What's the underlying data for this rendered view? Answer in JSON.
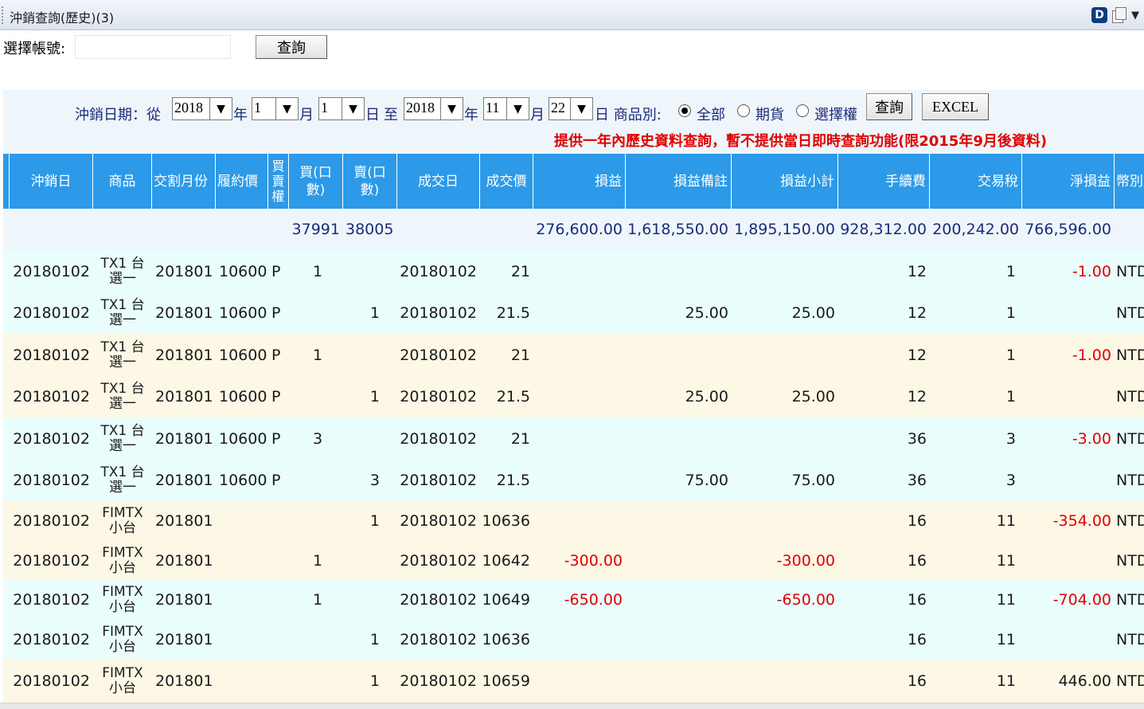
{
  "window": {
    "title": "沖銷查詢(歷史)(3)"
  },
  "account": {
    "label": "選擇帳號:",
    "value": "",
    "query_button": "查詢"
  },
  "filter": {
    "date_label": "沖銷日期：從",
    "from_year": "2018",
    "from_month": "1",
    "from_day": "1",
    "to_year": "2018",
    "to_month": "11",
    "to_day": "22",
    "year_label": "年",
    "month_label": "月",
    "day_label": "日",
    "to_label": "至",
    "day_label2": "日 商品別:",
    "product_options": [
      {
        "label": "全部",
        "selected": true
      },
      {
        "label": "期貨",
        "selected": false
      },
      {
        "label": "選擇權",
        "selected": false
      }
    ],
    "query_button": "查詢",
    "excel_button": "EXCEL",
    "notice": "提供一年內歷史資料查詢，暫不提供當日即時查詢功能(限2015年9月後資料)"
  },
  "table": {
    "columns": [
      "沖銷日",
      "商品",
      "交割月份",
      "履約價",
      "買賣權",
      "買(口數)",
      "賣(口數)",
      "成交日",
      "成交價",
      "損益",
      "損益備註",
      "損益小計",
      "手續費",
      "交易稅",
      "淨損益",
      "幣別"
    ],
    "header_display": {
      "buy_sell_flag": "買\n賣\n權",
      "buy_qty": "買(口\n數)",
      "sell_qty": "賣(口\n數)",
      "currency": "幣別"
    },
    "summary": {
      "buy_qty": "37991",
      "sell_qty": "38005",
      "pl": "276,600.00",
      "pl_note": "1,618,550.00",
      "pl_subtotal": "1,895,150.00",
      "fee": "928,312.00",
      "tax": "200,242.00",
      "net": "766,596.00"
    },
    "rows": [
      {
        "date": "20180102",
        "prod1": "TX1 台",
        "prod2": "選一",
        "month": "201801",
        "strike": "10600",
        "cp": "P",
        "buy": "1",
        "sell": "",
        "trade_date": "20180102",
        "price": "21",
        "pl": "",
        "pl_note": "",
        "pl_subtotal": "",
        "fee": "12",
        "tax": "1",
        "net": "-1.00",
        "currency": "NTD"
      },
      {
        "date": "20180102",
        "prod1": "TX1 台",
        "prod2": "選一",
        "month": "201801",
        "strike": "10600",
        "cp": "P",
        "buy": "",
        "sell": "1",
        "trade_date": "20180102",
        "price": "21.5",
        "pl": "",
        "pl_note": "25.00",
        "pl_subtotal": "25.00",
        "fee": "12",
        "tax": "1",
        "net": "",
        "currency": "NTD"
      },
      {
        "date": "20180102",
        "prod1": "TX1 台",
        "prod2": "選一",
        "month": "201801",
        "strike": "10600",
        "cp": "P",
        "buy": "1",
        "sell": "",
        "trade_date": "20180102",
        "price": "21",
        "pl": "",
        "pl_note": "",
        "pl_subtotal": "",
        "fee": "12",
        "tax": "1",
        "net": "-1.00",
        "currency": "NTD"
      },
      {
        "date": "20180102",
        "prod1": "TX1 台",
        "prod2": "選一",
        "month": "201801",
        "strike": "10600",
        "cp": "P",
        "buy": "",
        "sell": "1",
        "trade_date": "20180102",
        "price": "21.5",
        "pl": "",
        "pl_note": "25.00",
        "pl_subtotal": "25.00",
        "fee": "12",
        "tax": "1",
        "net": "",
        "currency": "NTD"
      },
      {
        "date": "20180102",
        "prod1": "TX1 台",
        "prod2": "選一",
        "month": "201801",
        "strike": "10600",
        "cp": "P",
        "buy": "3",
        "sell": "",
        "trade_date": "20180102",
        "price": "21",
        "pl": "",
        "pl_note": "",
        "pl_subtotal": "",
        "fee": "36",
        "tax": "3",
        "net": "-3.00",
        "currency": "NTD"
      },
      {
        "date": "20180102",
        "prod1": "TX1 台",
        "prod2": "選一",
        "month": "201801",
        "strike": "10600",
        "cp": "P",
        "buy": "",
        "sell": "3",
        "trade_date": "20180102",
        "price": "21.5",
        "pl": "",
        "pl_note": "75.00",
        "pl_subtotal": "75.00",
        "fee": "36",
        "tax": "3",
        "net": "",
        "currency": "NTD"
      },
      {
        "date": "20180102",
        "prod1": "FIMTX",
        "prod2": "小台",
        "month": "201801",
        "strike": "",
        "cp": "",
        "buy": "",
        "sell": "1",
        "trade_date": "20180102",
        "price": "10636",
        "pl": "",
        "pl_note": "",
        "pl_subtotal": "",
        "fee": "16",
        "tax": "11",
        "net": "-354.00",
        "currency": "NTD"
      },
      {
        "date": "20180102",
        "prod1": "FIMTX",
        "prod2": "小台",
        "month": "201801",
        "strike": "",
        "cp": "",
        "buy": "1",
        "sell": "",
        "trade_date": "20180102",
        "price": "10642",
        "pl": "-300.00",
        "pl_note": "",
        "pl_subtotal": "-300.00",
        "fee": "16",
        "tax": "11",
        "net": "",
        "currency": "NTD"
      },
      {
        "date": "20180102",
        "prod1": "FIMTX",
        "prod2": "小台",
        "month": "201801",
        "strike": "",
        "cp": "",
        "buy": "1",
        "sell": "",
        "trade_date": "20180102",
        "price": "10649",
        "pl": "-650.00",
        "pl_note": "",
        "pl_subtotal": "-650.00",
        "fee": "16",
        "tax": "11",
        "net": "-704.00",
        "currency": "NTD"
      },
      {
        "date": "20180102",
        "prod1": "FIMTX",
        "prod2": "小台",
        "month": "201801",
        "strike": "",
        "cp": "",
        "buy": "",
        "sell": "1",
        "trade_date": "20180102",
        "price": "10636",
        "pl": "",
        "pl_note": "",
        "pl_subtotal": "",
        "fee": "16",
        "tax": "11",
        "net": "",
        "currency": "NTD"
      },
      {
        "date": "20180102",
        "prod1": "FIMTX",
        "prod2": "小台",
        "month": "201801",
        "strike": "",
        "cp": "",
        "buy": "",
        "sell": "1",
        "trade_date": "20180102",
        "price": "10659",
        "pl": "",
        "pl_note": "",
        "pl_subtotal": "",
        "fee": "16",
        "tax": "11",
        "net": "446.00",
        "currency": "NTD"
      }
    ]
  },
  "colors": {
    "header": "#2c9ae8",
    "row_cyan": "#eafdfd",
    "row_cream": "#fdf7e6",
    "negative": "#e00000",
    "label_blue": "#1d2b7a"
  }
}
